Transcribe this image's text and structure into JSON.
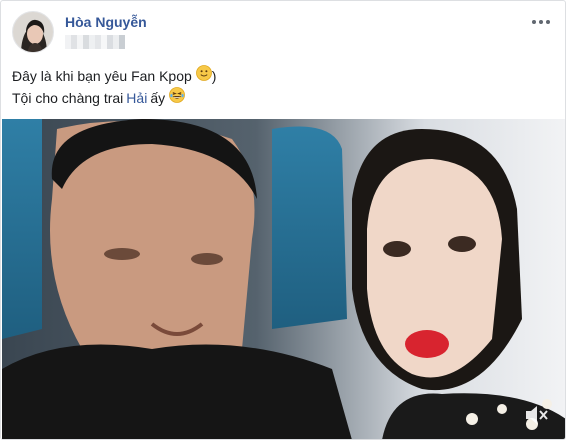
{
  "author": {
    "name": "Hòa Nguyễn",
    "avatar": "profile-photo"
  },
  "post": {
    "line1_text": "Đây là khi bạn yêu Fan Kpop",
    "line1_suffix": ")",
    "line2_prefix": "Tội cho chàng trai",
    "line2_highlight": "Hải",
    "line2_suffix": "ấy"
  },
  "icons": {
    "more": "more-options-icon",
    "smile": "slightly-smiling-face-emoji",
    "laugh": "grinning-squinting-face-emoji",
    "mute": "speaker-muted-icon"
  },
  "colors": {
    "author_name": "#365899",
    "link_text": "#365899",
    "border": "#dddfe2"
  },
  "video": {
    "description": "selfie"
  }
}
